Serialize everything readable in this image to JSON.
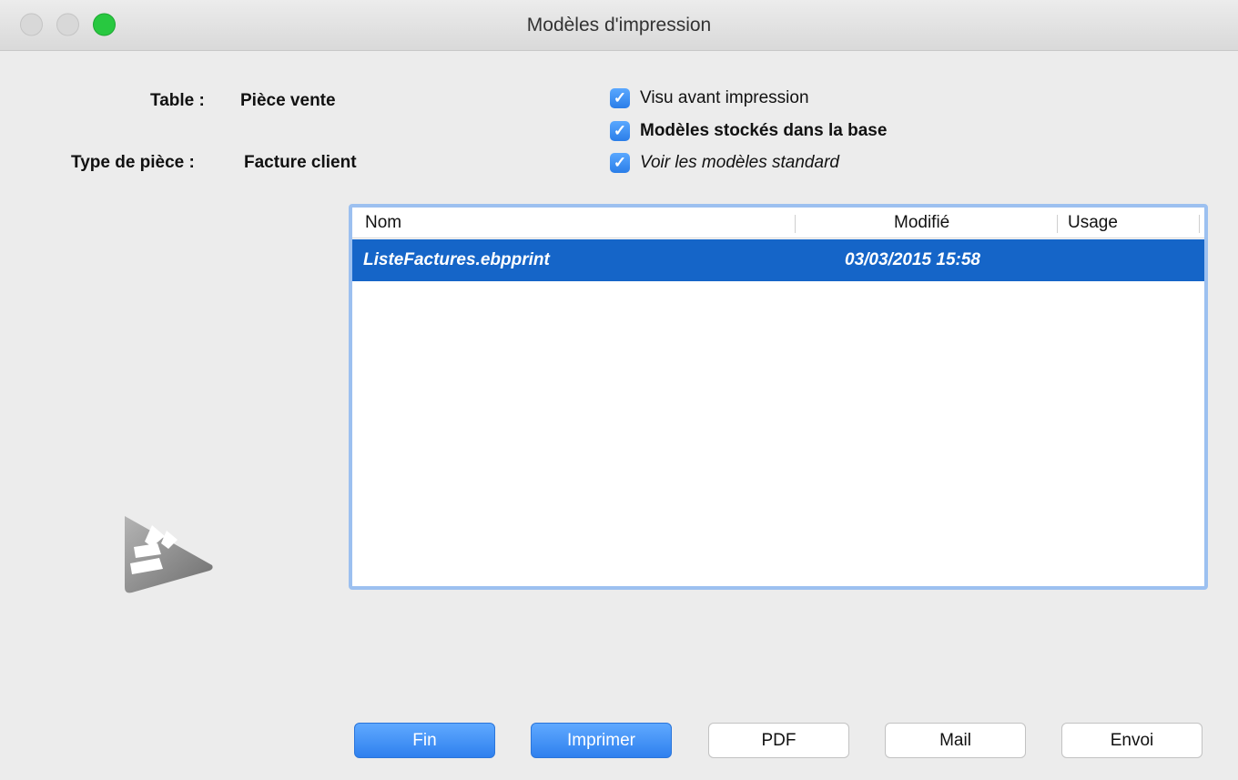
{
  "window": {
    "title": "Modèles d'impression"
  },
  "info": {
    "table_label": "Table :",
    "table_value": "Pièce vente",
    "type_label": "Type de pièce :",
    "type_value": "Facture client"
  },
  "options": [
    {
      "label": "Visu avant impression",
      "checked": true
    },
    {
      "label": "Modèles stockés dans la base",
      "checked": true
    },
    {
      "label": "Voir les modèles standard",
      "checked": true
    }
  ],
  "list": {
    "columns": [
      "Nom",
      "Modifié",
      "Usage"
    ],
    "rows": [
      {
        "nom": "ListeFactures.ebpprint",
        "modifie": "03/03/2015 15:58",
        "usage": "",
        "selected": true
      }
    ]
  },
  "buttons": {
    "fin": "Fin",
    "imprimer": "Imprimer",
    "pdf": "PDF",
    "mail": "Mail",
    "envoi": "Envoi"
  },
  "colors": {
    "accent": "#2f80ee",
    "selection": "#1565c8",
    "zoom_button": "#28c840"
  }
}
